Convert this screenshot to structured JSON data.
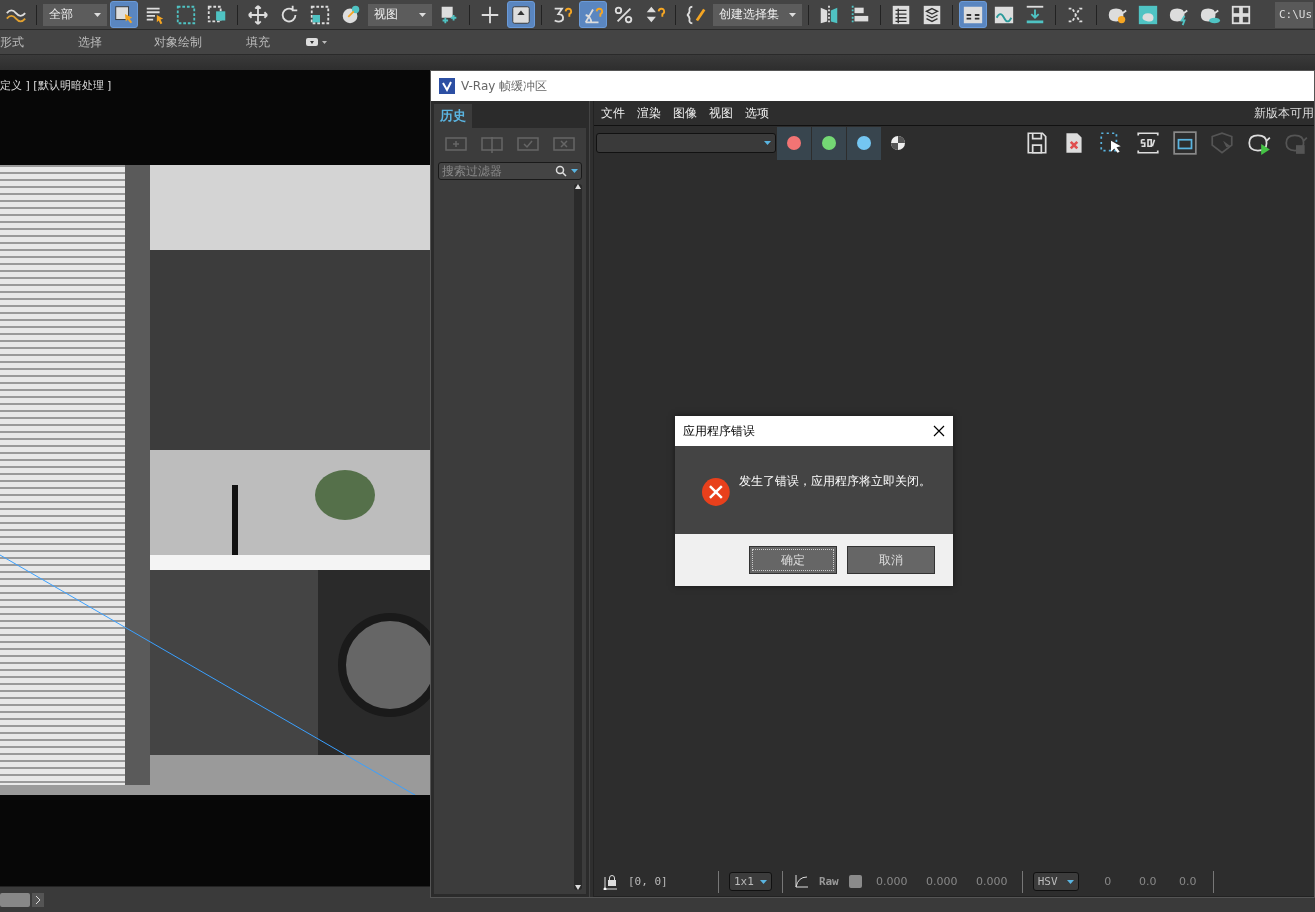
{
  "app_toolbar": {
    "items": [
      {
        "kind": "tool",
        "selected": false
      },
      {
        "kind": "separator"
      },
      {
        "kind": "dropdown",
        "value": "全部"
      },
      {
        "kind": "tool",
        "selected": true
      },
      {
        "kind": "tool",
        "selected": false
      },
      {
        "kind": "tool",
        "selected": false
      },
      {
        "kind": "tool",
        "selected": false
      },
      {
        "kind": "separator"
      },
      {
        "kind": "tool",
        "selected": false
      },
      {
        "kind": "tool",
        "selected": false
      },
      {
        "kind": "tool",
        "selected": false
      },
      {
        "kind": "tool",
        "selected": false
      },
      {
        "kind": "dropdown",
        "value": "视图"
      },
      {
        "kind": "tool",
        "selected": false
      },
      {
        "kind": "separator"
      },
      {
        "kind": "tool",
        "selected": false
      },
      {
        "kind": "tool",
        "selected": true
      },
      {
        "kind": "separator"
      },
      {
        "kind": "tool",
        "selected": false
      },
      {
        "kind": "tool",
        "selected": true
      },
      {
        "kind": "tool",
        "selected": false
      },
      {
        "kind": "tool",
        "selected": false
      },
      {
        "kind": "separator"
      },
      {
        "kind": "tool",
        "selected": false
      },
      {
        "kind": "dropdown",
        "value": "创建选择集"
      },
      {
        "kind": "separator"
      },
      {
        "kind": "tool",
        "selected": false
      },
      {
        "kind": "tool",
        "selected": false
      },
      {
        "kind": "separator"
      },
      {
        "kind": "tool",
        "selected": false
      },
      {
        "kind": "tool",
        "selected": false
      },
      {
        "kind": "separator"
      },
      {
        "kind": "tool",
        "selected": true
      },
      {
        "kind": "tool",
        "selected": false
      },
      {
        "kind": "tool",
        "selected": false
      },
      {
        "kind": "separator"
      },
      {
        "kind": "tool",
        "selected": false
      },
      {
        "kind": "separator"
      },
      {
        "kind": "tool",
        "selected": false
      },
      {
        "kind": "tool",
        "selected": false
      },
      {
        "kind": "tool",
        "selected": false
      },
      {
        "kind": "tool",
        "selected": false
      },
      {
        "kind": "tool",
        "selected": false
      }
    ],
    "path_field": "C:\\Us"
  },
  "ribbon_tabs": [
    "形式",
    "选择",
    "对象绘制",
    "填充"
  ],
  "viewport": {
    "label": "定义 ] [默认明暗处理 ]"
  },
  "vray": {
    "title": "V-Ray 帧缓冲区",
    "history": {
      "tab": {
        "label": "历史",
        "selected": true
      },
      "search": {
        "placeholder": "搜索过滤器"
      }
    },
    "menu": [
      "文件",
      "渲染",
      "图像",
      "视图",
      "选项"
    ],
    "notice": "新版本可用",
    "channels": [
      {
        "color": "#f27474"
      },
      {
        "color": "#74d874"
      },
      {
        "color": "#74c6f2"
      }
    ],
    "status": {
      "coords": "[0, 0]",
      "zoom": "1x1",
      "raw": "Raw",
      "raw_values": [
        "0.000",
        "0.000",
        "0.000"
      ],
      "mode": "HSV",
      "mode_values": [
        "0",
        "0.0",
        "0.0"
      ]
    }
  },
  "dialog": {
    "title": "应用程序错误",
    "message": "发生了错误，应用程序将立即关闭。",
    "buttons": [
      {
        "label": "确定",
        "focused": true
      },
      {
        "label": "取消",
        "focused": false
      }
    ]
  }
}
